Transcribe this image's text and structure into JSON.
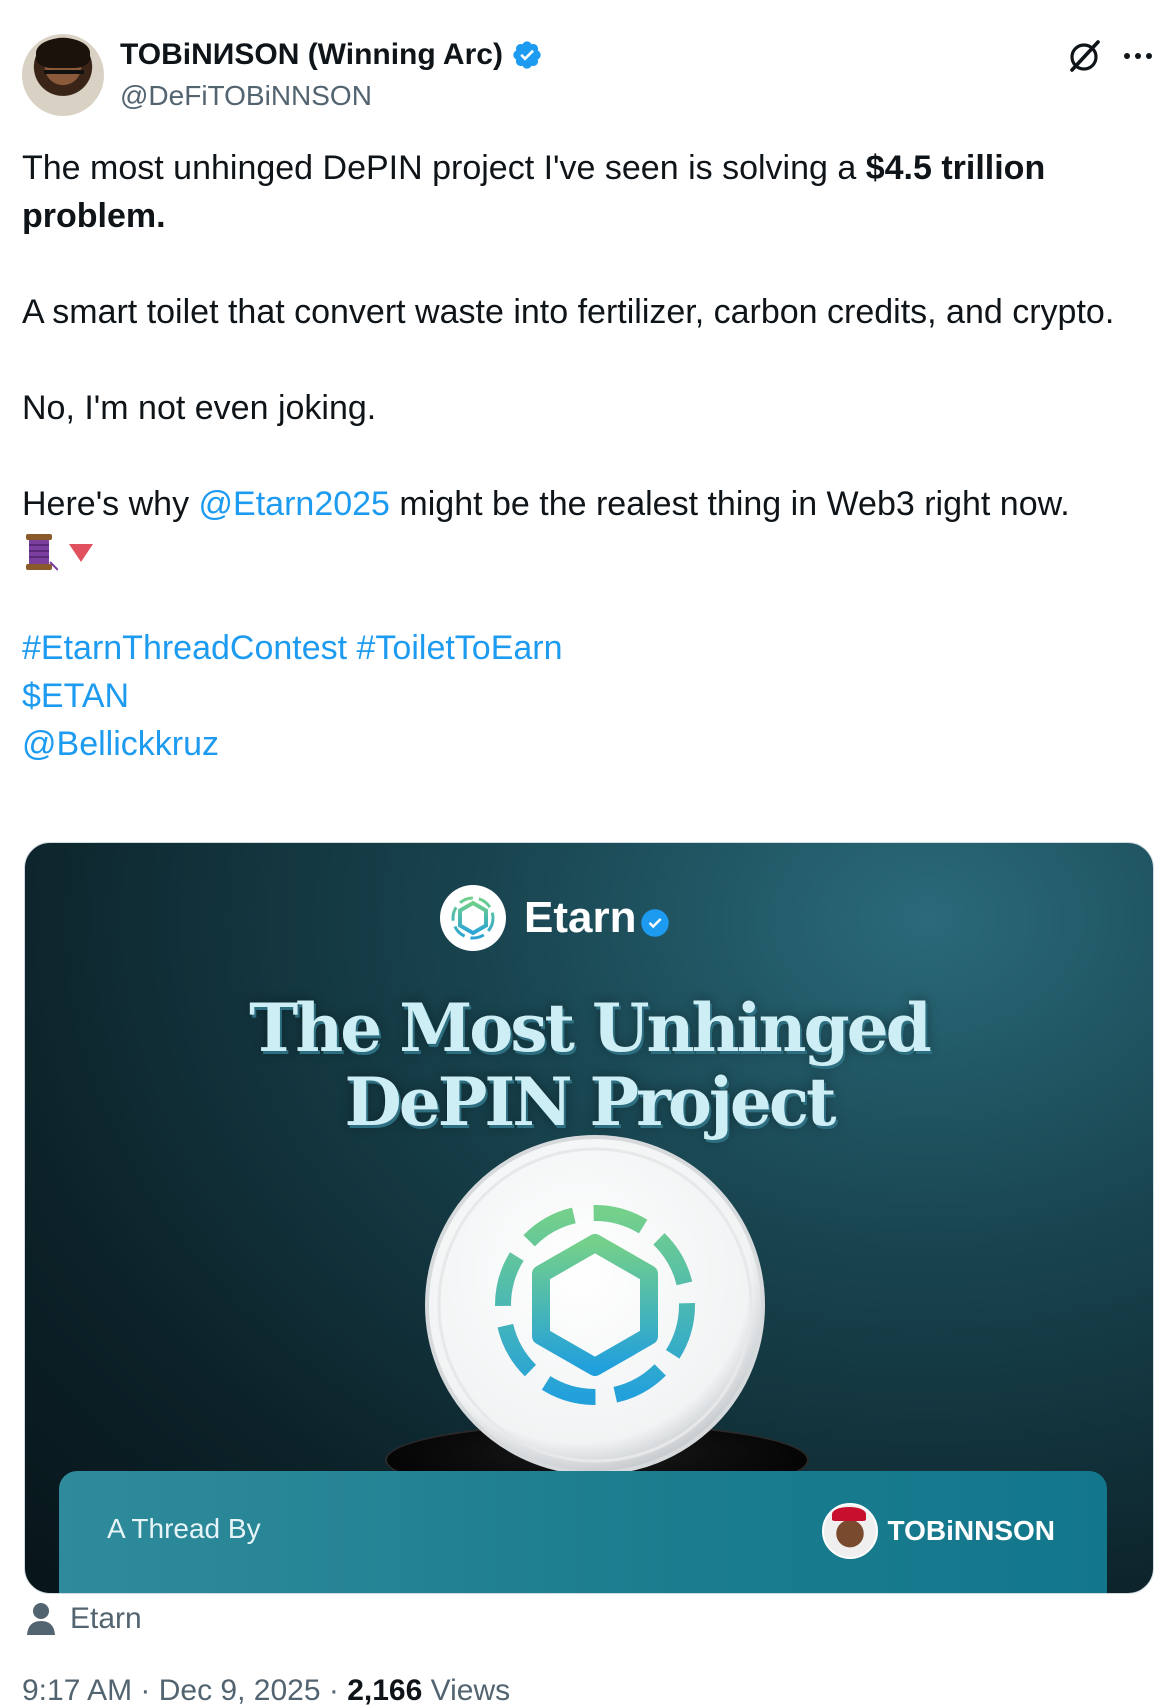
{
  "author": {
    "display_name": "TOBiNИSON (Winning Arc)",
    "handle": "@DeFiTOBiNNSON"
  },
  "tweet": {
    "line1_text": "The most unhinged DePIN project I've seen is solving a ",
    "line1_bold": "$4.5 trillion problem.",
    "line2": "A smart toilet that convert waste into fertilizer, carbon credits, and crypto.",
    "line3": "No, I'm not even joking.",
    "line4_before": "Here's why ",
    "line4_mention": "@Etarn2025",
    "line4_after": " might be the realest thing in Web3 right now.",
    "hashtags": "#EtarnThreadContest #ToiletToEarn",
    "cashtag": "$ETAN",
    "mention2": "@Bellickkruz"
  },
  "media": {
    "brand_name": "Etarn",
    "headline_line1": "The Most Unhinged",
    "headline_line2": "DePIN Project",
    "thread_by": "A Thread By",
    "author_name": "TOBiNNSON"
  },
  "attribution": "Etarn",
  "meta": {
    "time": "9:17 AM",
    "date": "Dec 9, 2025",
    "views_count": "2,166",
    "views_label": "Views",
    "separator": " · "
  },
  "icons": {
    "verified": "verified-badge-icon",
    "grok": "grok-icon",
    "more": "more-icon",
    "thread": "thread-spool-icon",
    "down": "down-triangle-icon",
    "person": "person-icon"
  },
  "colors": {
    "accent": "#1d9bf0",
    "text": "#0f1419",
    "secondary": "#536471"
  }
}
